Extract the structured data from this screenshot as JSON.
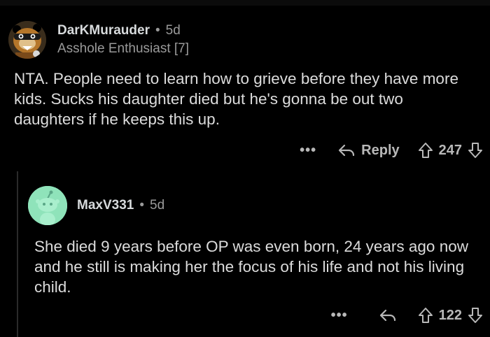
{
  "comments": [
    {
      "username": "DarKMurauder",
      "separator": "•",
      "time": "5d",
      "flair": "Asshole Enthusiast [7]",
      "body": "NTA. People need to learn how to grieve before they have more kids. Sucks his daughter died but he's gonna be out two daughters if he keeps this up.",
      "more_label": "•••",
      "reply_label": "Reply",
      "score": "247",
      "avatar_icon": "mascot-avatar-icon"
    },
    {
      "username": "MaxV331",
      "separator": "•",
      "time": "5d",
      "body": "She died 9 years before OP was even born, 24 years ago now and he still is making her the focus of his life and not his living child.",
      "more_label": "•••",
      "score": "122",
      "avatar_icon": "snoo-avatar-icon"
    }
  ],
  "colors": {
    "background": "#000000",
    "text": "#dcdcdc",
    "muted": "#9a9a9a",
    "avatar2_bg": "#8fe3ba"
  }
}
